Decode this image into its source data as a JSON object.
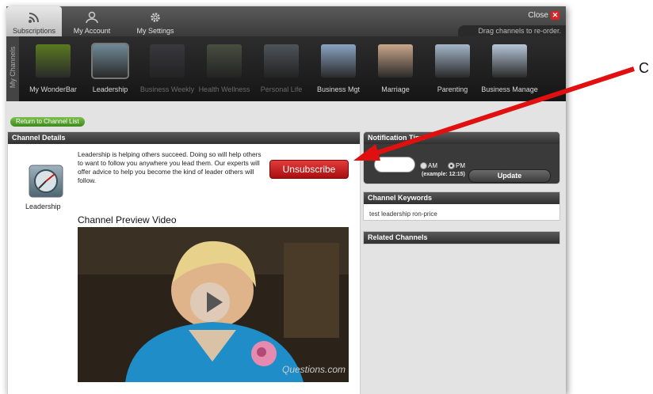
{
  "tabs": {
    "subscriptions": "Subscriptions",
    "my_account": "My Account",
    "my_settings": "My Settings"
  },
  "close_label": "Close",
  "drag_hint": "Drag channels to re-order.",
  "my_channels_label": "My Channels",
  "channels": [
    {
      "label": "My WonderBar",
      "thumb": "#5a7a20",
      "dim": false
    },
    {
      "label": "Leadership",
      "thumb": "#6f8a96",
      "dim": false
    },
    {
      "label": "Business Weekly",
      "thumb": "#4a4a56",
      "dim": true
    },
    {
      "label": "Health Wellness",
      "thumb": "#6f7a5a",
      "dim": true
    },
    {
      "label": "Personal Life",
      "thumb": "#7a8694",
      "dim": true
    },
    {
      "label": "Business Mgt",
      "thumb": "#8aa3c2",
      "dim": false
    },
    {
      "label": "Marriage",
      "thumb": "#c9a78a",
      "dim": false
    },
    {
      "label": "Parenting",
      "thumb": "#a4b6c9",
      "dim": false
    },
    {
      "label": "Business Manage",
      "thumb": "#b7c6d9",
      "dim": false
    }
  ],
  "return_button": "Return to Channel List",
  "details": {
    "header": "Channel Details",
    "channel_name": "Leadership",
    "description": "Leadership is helping others succeed. Doing so will help others to want to follow you anywhere you lead them. Our experts will offer advice to help you become the kind of leader others will follow.",
    "unsubscribe": "Unsubscribe",
    "preview_title": "Channel Preview Video",
    "watermark": "Questions.com"
  },
  "notification": {
    "header": "Notification Time",
    "am": "AM",
    "pm": "PM",
    "example": "(example: 12:15)",
    "update": "Update"
  },
  "keywords": {
    "header": "Channel Keywords",
    "text": "test  leadership  ron-price"
  },
  "related": {
    "header": "Related Channels"
  },
  "callout_text": "C",
  "colors": {
    "accent_red": "#c31919",
    "return_green": "#4e9a2a",
    "header_dark": "#3a3a3a"
  }
}
